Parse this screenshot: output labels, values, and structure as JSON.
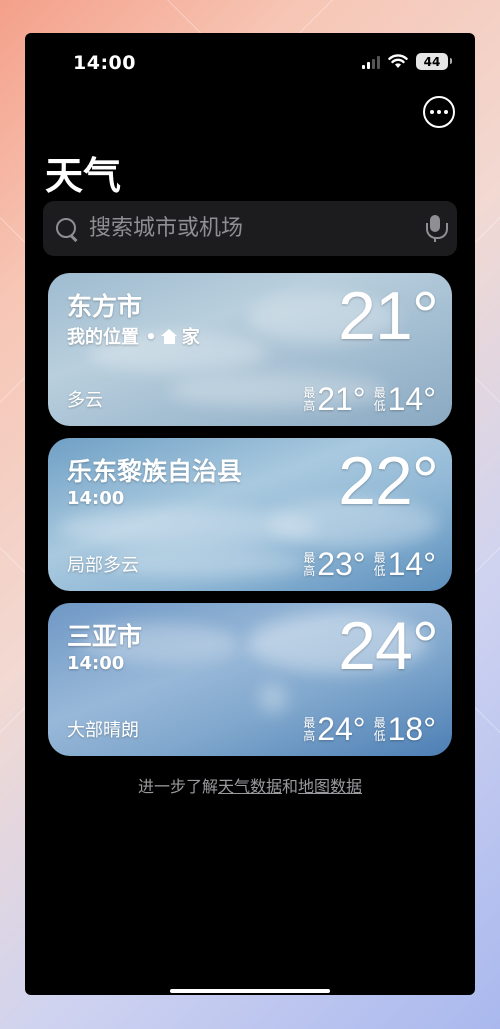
{
  "status_bar": {
    "time": "14:00",
    "battery": "44"
  },
  "header": {
    "title": "天气"
  },
  "search": {
    "placeholder": "搜索城市或机场"
  },
  "cities": [
    {
      "name": "东方市",
      "subtitle": "我的位置 •",
      "home_label": "家",
      "temp": "21°",
      "condition": "多云",
      "high_tag_1": "最",
      "high_tag_2": "高",
      "high": "21°",
      "low_tag_1": "最",
      "low_tag_2": "低",
      "low": "14°"
    },
    {
      "name": "乐东黎族自治县",
      "subtitle": "14:00",
      "temp": "22°",
      "condition": "局部多云",
      "high_tag_1": "最",
      "high_tag_2": "高",
      "high": "23°",
      "low_tag_1": "最",
      "low_tag_2": "低",
      "low": "14°"
    },
    {
      "name": "三亚市",
      "subtitle": "14:00",
      "temp": "24°",
      "condition": "大部晴朗",
      "high_tag_1": "最",
      "high_tag_2": "高",
      "high": "24°",
      "low_tag_1": "最",
      "low_tag_2": "低",
      "low": "18°"
    }
  ],
  "footer": {
    "prefix": "进一步了解",
    "weather_link": "天气数据",
    "connector": "和",
    "map_link": "地图数据"
  }
}
